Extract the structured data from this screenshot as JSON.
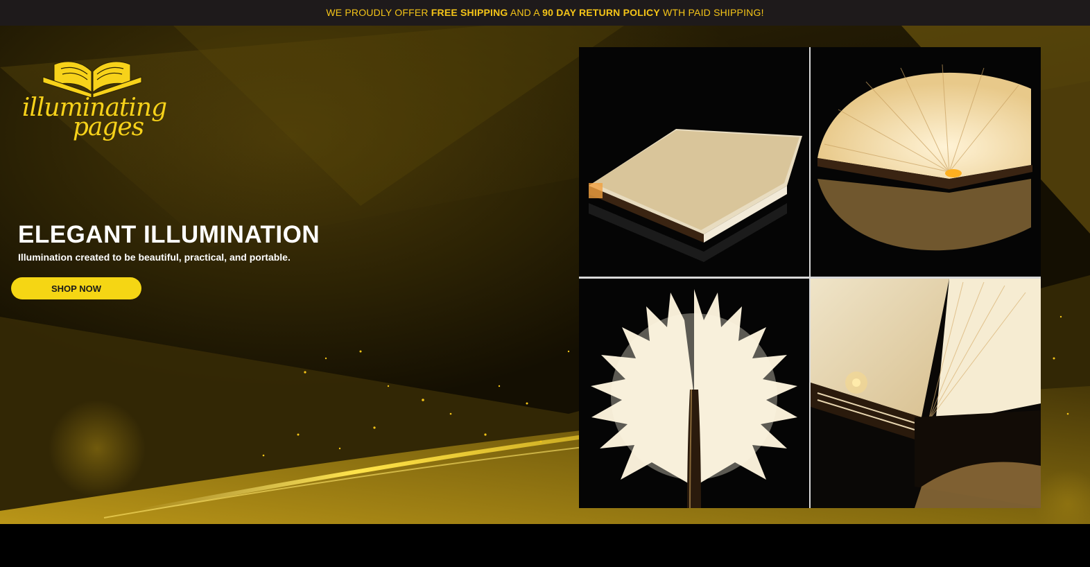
{
  "announcement": {
    "part1": "WE PROUDLY OFFER ",
    "bold1": "FREE SHIPPING",
    "part2": " AND A ",
    "bold2": "90 DAY RETURN POLICY",
    "part3": " WTH PAID SHIPPING!"
  },
  "logo": {
    "line1": "illuminating",
    "line2": "pages",
    "icon": "open-book-icon"
  },
  "hero": {
    "headline": "ELEGANT ILLUMINATION",
    "subline": "Illumination created to be beautiful, practical, and portable.",
    "cta_label": "SHOP NOW"
  },
  "gallery": {
    "images": [
      "closed-book-lamp",
      "half-open-book-lamp",
      "fully-open-book-lamp",
      "book-lamp-closeup"
    ]
  },
  "colors": {
    "accent": "#f5d614",
    "announce_bg": "#1e1a1b",
    "announce_text": "#f5c518"
  }
}
